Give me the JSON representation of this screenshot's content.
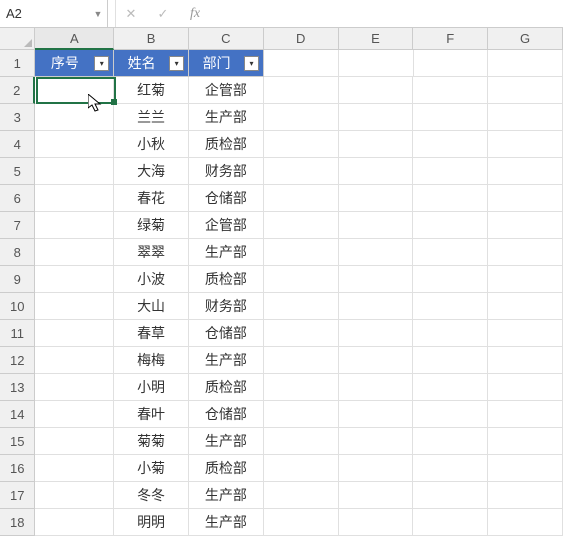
{
  "name_box": "A2",
  "formula_input": "",
  "col_labels": [
    "A",
    "B",
    "C",
    "D",
    "E",
    "F",
    "G"
  ],
  "row_labels": [
    "1",
    "2",
    "3",
    "4",
    "5",
    "6",
    "7",
    "8",
    "9",
    "10",
    "11",
    "12",
    "13",
    "14",
    "15",
    "16",
    "17",
    "18"
  ],
  "active_col": "A",
  "active_row": 2,
  "headers": {
    "a": "序号",
    "b": "姓名",
    "c": "部门"
  },
  "rows": [
    {
      "b": "红菊",
      "c": "企管部"
    },
    {
      "b": "兰兰",
      "c": "生产部"
    },
    {
      "b": "小秋",
      "c": "质检部"
    },
    {
      "b": "大海",
      "c": "财务部"
    },
    {
      "b": "春花",
      "c": "仓储部"
    },
    {
      "b": "绿菊",
      "c": "企管部"
    },
    {
      "b": "翠翠",
      "c": "生产部"
    },
    {
      "b": "小波",
      "c": "质检部"
    },
    {
      "b": "大山",
      "c": "财务部"
    },
    {
      "b": "春草",
      "c": "仓储部"
    },
    {
      "b": "梅梅",
      "c": "生产部"
    },
    {
      "b": "小明",
      "c": "质检部"
    },
    {
      "b": "春叶",
      "c": "仓储部"
    },
    {
      "b": "菊菊",
      "c": "生产部"
    },
    {
      "b": "小菊",
      "c": "质检部"
    },
    {
      "b": "冬冬",
      "c": "生产部"
    },
    {
      "b": "明明",
      "c": "生产部"
    }
  ],
  "chart_data": {
    "type": "table",
    "title": "",
    "columns": [
      "序号",
      "姓名",
      "部门"
    ],
    "rows": [
      [
        "",
        "红菊",
        "企管部"
      ],
      [
        "",
        "兰兰",
        "生产部"
      ],
      [
        "",
        "小秋",
        "质检部"
      ],
      [
        "",
        "大海",
        "财务部"
      ],
      [
        "",
        "春花",
        "仓储部"
      ],
      [
        "",
        "绿菊",
        "企管部"
      ],
      [
        "",
        "翠翠",
        "生产部"
      ],
      [
        "",
        "小波",
        "质检部"
      ],
      [
        "",
        "大山",
        "财务部"
      ],
      [
        "",
        "春草",
        "仓储部"
      ],
      [
        "",
        "梅梅",
        "生产部"
      ],
      [
        "",
        "小明",
        "质检部"
      ],
      [
        "",
        "春叶",
        "仓储部"
      ],
      [
        "",
        "菊菊",
        "生产部"
      ],
      [
        "",
        "小菊",
        "质检部"
      ],
      [
        "",
        "冬冬",
        "生产部"
      ],
      [
        "",
        "明明",
        "生产部"
      ]
    ]
  }
}
